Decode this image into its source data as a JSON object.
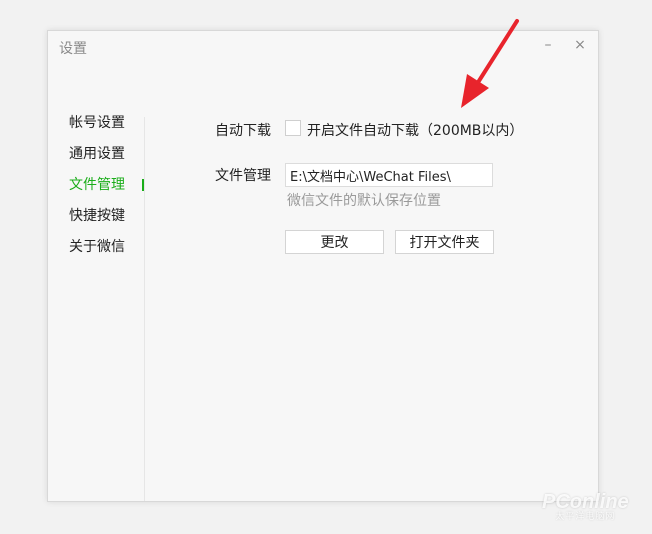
{
  "window": {
    "title": "设置",
    "minimize_glyph": "–",
    "close_glyph": "×"
  },
  "sidebar": {
    "items": [
      {
        "label": "帐号设置",
        "active": false
      },
      {
        "label": "通用设置",
        "active": false
      },
      {
        "label": "文件管理",
        "active": true
      },
      {
        "label": "快捷按键",
        "active": false
      },
      {
        "label": "关于微信",
        "active": false
      }
    ]
  },
  "file_settings": {
    "auto_download": {
      "label": "自动下载",
      "checkbox_label": "开启文件自动下载（200MB以内）",
      "checked": false
    },
    "file_management": {
      "label": "文件管理",
      "path_value": "E:\\文档中心\\WeChat Files\\",
      "hint": "微信文件的默认保存位置"
    },
    "buttons": {
      "change": "更改",
      "open_folder": "打开文件夹"
    }
  },
  "annotation": {
    "arrow_color": "#e8242c",
    "arrow_icon": "red-arrow-icon"
  },
  "watermark": {
    "brand": "PConline",
    "sub": "太平洋电脑网"
  },
  "colors": {
    "accent": "#1aad19",
    "hint": "#9a9a9a",
    "background": "#f7f7f7"
  }
}
